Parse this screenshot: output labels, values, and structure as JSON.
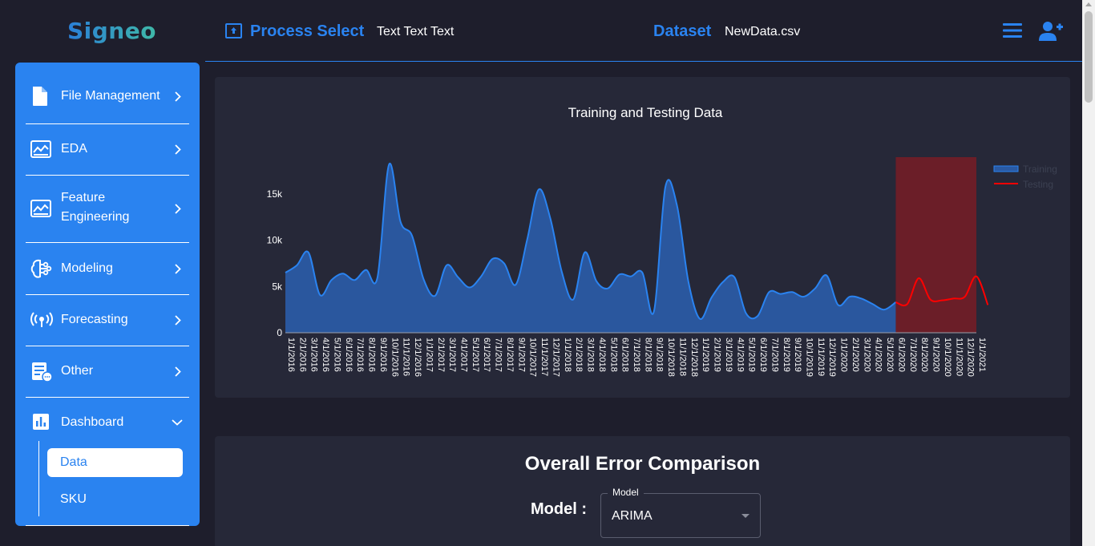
{
  "app": {
    "logo": "Signeo"
  },
  "header": {
    "process_title": "Process Select",
    "process_text": "Text Text Text",
    "dataset_title": "Dataset",
    "dataset_file": "NewData.csv"
  },
  "sidebar": {
    "items": [
      {
        "label": "File Management",
        "icon": "file-icon"
      },
      {
        "label": "EDA",
        "icon": "chart-image-icon"
      },
      {
        "label": "Feature Engineering",
        "icon": "chart-image-icon"
      },
      {
        "label": "Modeling",
        "icon": "brain-icon"
      },
      {
        "label": "Forecasting",
        "icon": "broadcast-icon"
      },
      {
        "label": "Other",
        "icon": "document-chat-icon"
      },
      {
        "label": "Dashboard",
        "icon": "bar-chart-icon"
      }
    ],
    "subitems": [
      {
        "label": "Data",
        "selected": true
      },
      {
        "label": "SKU",
        "selected": false
      }
    ]
  },
  "chart_data": {
    "type": "area",
    "title": "Training and Testing Data",
    "xlabel": "",
    "ylabel": "",
    "ylim": [
      0,
      19000
    ],
    "yticks": [
      0,
      5000,
      10000,
      15000
    ],
    "ytick_labels": [
      "0",
      "5k",
      "10k",
      "15k"
    ],
    "legend_position": "top-right",
    "grid": false,
    "colors": {
      "training": "#2a83f0",
      "training_fill": "#2a5aa3",
      "testing": "#ff0000",
      "testing_band": "#6b1e28"
    },
    "x": [
      "1/1/2016",
      "2/1/2016",
      "3/1/2016",
      "4/1/2016",
      "5/1/2016",
      "6/1/2016",
      "7/1/2016",
      "8/1/2016",
      "9/1/2016",
      "10/1/2016",
      "11/1/2016",
      "12/1/2016",
      "1/1/2017",
      "2/1/2017",
      "3/1/2017",
      "4/1/2017",
      "5/1/2017",
      "6/1/2017",
      "7/1/2017",
      "8/1/2017",
      "9/1/2017",
      "10/1/2017",
      "11/1/2017",
      "12/1/2017",
      "1/1/2018",
      "2/1/2018",
      "3/1/2018",
      "4/1/2018",
      "5/1/2018",
      "6/1/2018",
      "7/1/2018",
      "8/1/2018",
      "9/1/2018",
      "10/1/2018",
      "11/1/2018",
      "12/1/2018",
      "1/1/2019",
      "2/1/2019",
      "3/1/2019",
      "4/1/2019",
      "5/1/2019",
      "6/1/2019",
      "7/1/2019",
      "8/1/2019",
      "9/1/2019",
      "10/1/2019",
      "11/1/2019",
      "12/1/2019",
      "1/1/2020",
      "2/1/2020",
      "3/1/2020",
      "4/1/2020",
      "5/1/2020",
      "6/1/2020",
      "7/1/2020",
      "8/1/2020",
      "9/1/2020",
      "10/1/2020",
      "11/1/2020",
      "12/1/2020",
      "1/1/2021"
    ],
    "series": [
      {
        "name": "Training",
        "start": 0,
        "values": [
          6500,
          7300,
          8700,
          4100,
          5700,
          6400,
          5700,
          6800,
          6000,
          18200,
          12000,
          10500,
          5800,
          4000,
          7300,
          6000,
          4900,
          6100,
          8000,
          7500,
          5200,
          10100,
          15500,
          12400,
          6600,
          3600,
          8700,
          5600,
          4800,
          6300,
          6100,
          6500,
          2300,
          15800,
          13800,
          5500,
          1500,
          3800,
          5500,
          6000,
          2100,
          1800,
          4400,
          4200,
          4400,
          3900,
          4800,
          6200,
          3000,
          3900,
          3700,
          3100,
          2500,
          3300
        ]
      },
      {
        "name": "Testing",
        "start": 53,
        "values": [
          3300,
          3100,
          5900,
          3600,
          3500,
          3700,
          3900,
          6100,
          3000
        ]
      }
    ]
  },
  "error_section": {
    "title": "Overall Error Comparison",
    "model_label": "Model :",
    "select_legend": "Model",
    "select_value": "ARIMA"
  }
}
